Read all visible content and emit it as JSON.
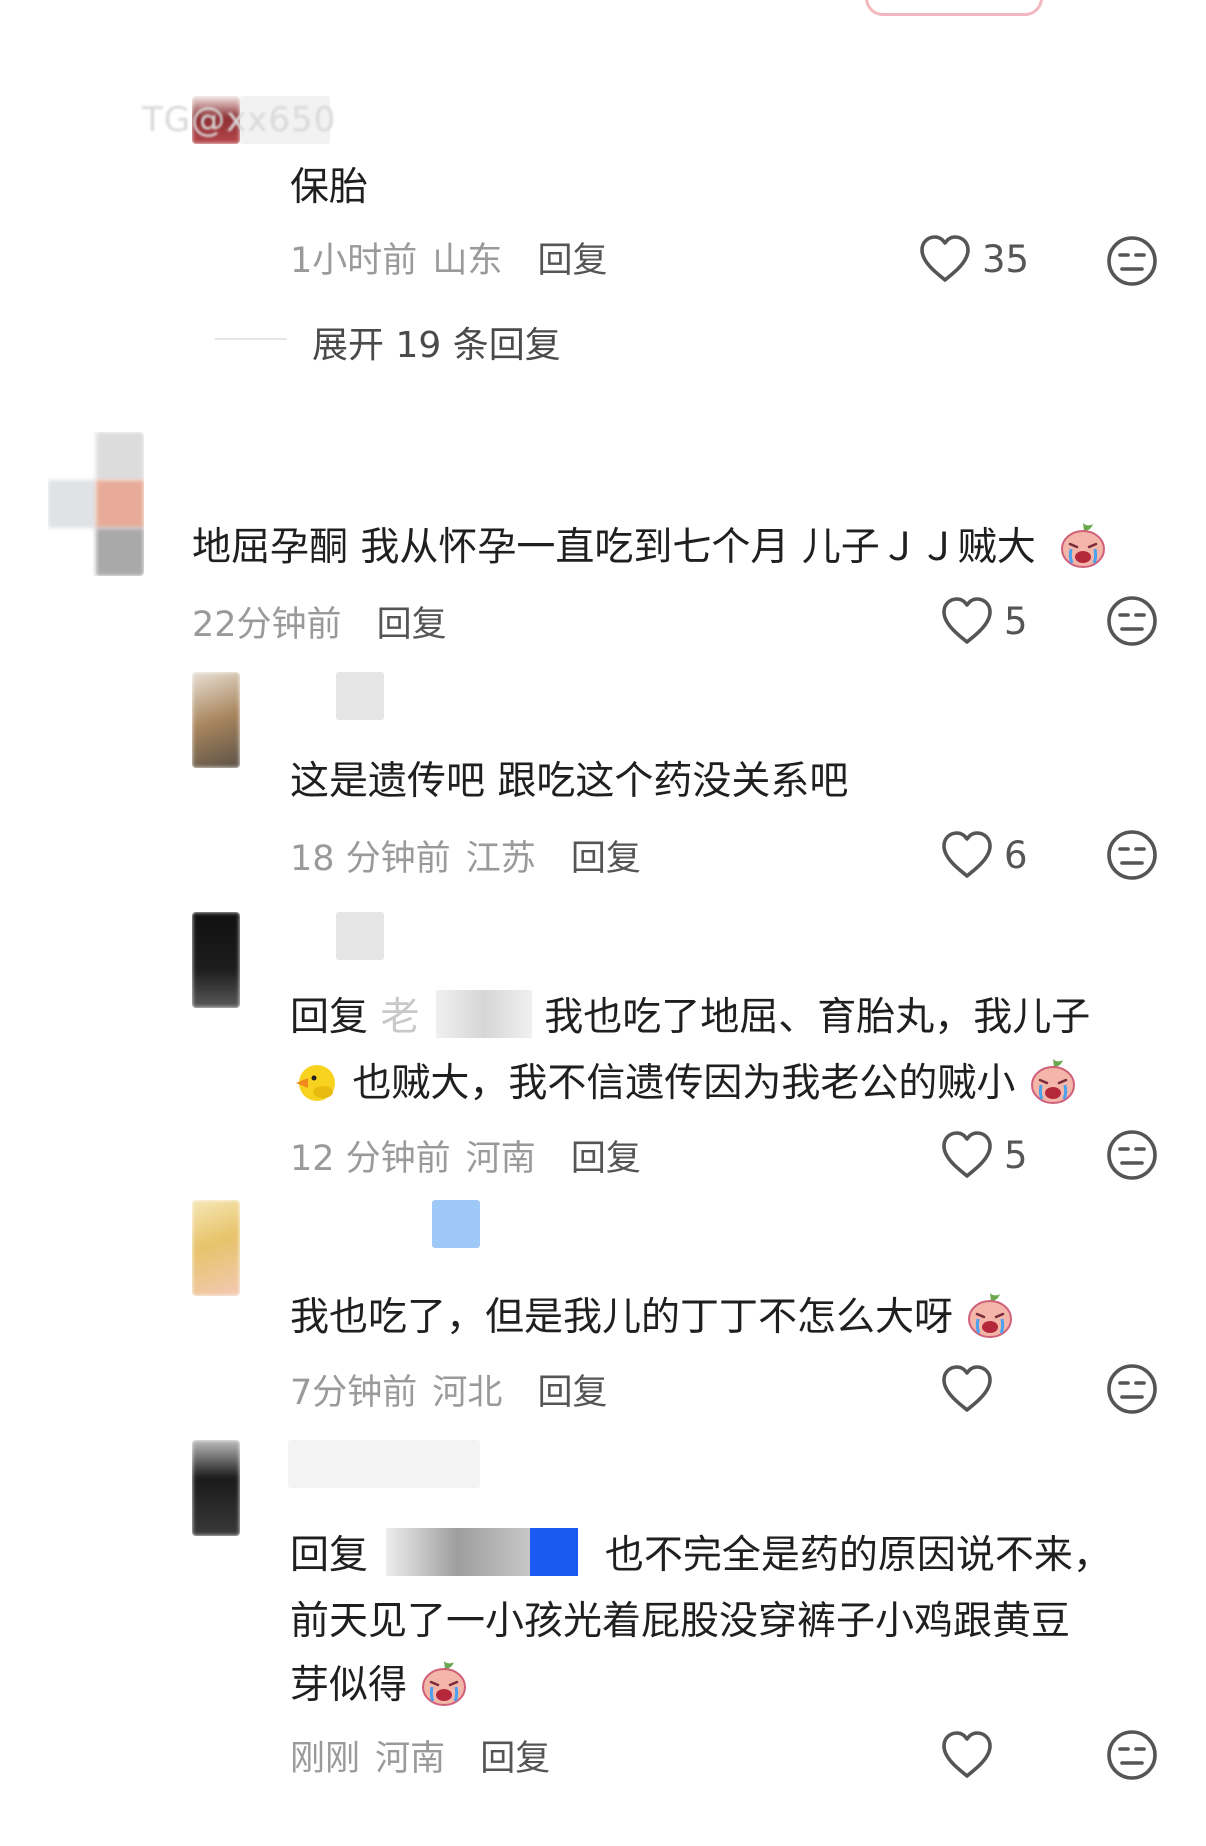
{
  "watermark": "TG@xx650",
  "thread_top": {
    "text": "保胎",
    "time": "1小时前",
    "location": "山东",
    "reply": "回复",
    "likes": "35",
    "expand": "展开 19 条回复"
  },
  "comment_main": {
    "text": "地屈孕酮 我从怀孕一直吃到七个月  儿子ＪＪ贼大",
    "time": "22分钟前",
    "reply": "回复",
    "likes": "5"
  },
  "replies": [
    {
      "text": "这是遗传吧 跟吃这个药没关系吧",
      "time": "18 分钟前",
      "location": "江苏",
      "reply": "回复",
      "likes": "6"
    },
    {
      "prefix": "回复",
      "mention": "老",
      "line1": "我也吃了地屈、育胎丸，我儿子",
      "line2": "也贼大，我不信遗传因为我老公的贼小",
      "time": "12 分钟前",
      "location": "河南",
      "reply": "回复",
      "likes": "5"
    },
    {
      "text": "我也吃了，但是我儿的丁丁不怎么大呀",
      "time": "7分钟前",
      "location": "河北",
      "reply": "回复",
      "likes": ""
    },
    {
      "prefix": "回复",
      "line1": "也不完全是药的原因说不来，",
      "line2": "前天见了一小孩光着屁股没穿裤子小鸡跟黄豆",
      "line3": "芽似得",
      "time": "刚刚",
      "location": "河南",
      "reply": "回复",
      "likes": ""
    }
  ],
  "icons": {
    "like": "heart-outline-icon",
    "dislike": "neutral-face-icon",
    "emoji_cry": "crying-face-emoji",
    "emoji_duck": "duck-emoji"
  },
  "colors": {
    "text": "#1f1f1f",
    "meta": "#9a9a9a",
    "icon": "#555555",
    "button_border": "#f2b8bf"
  }
}
